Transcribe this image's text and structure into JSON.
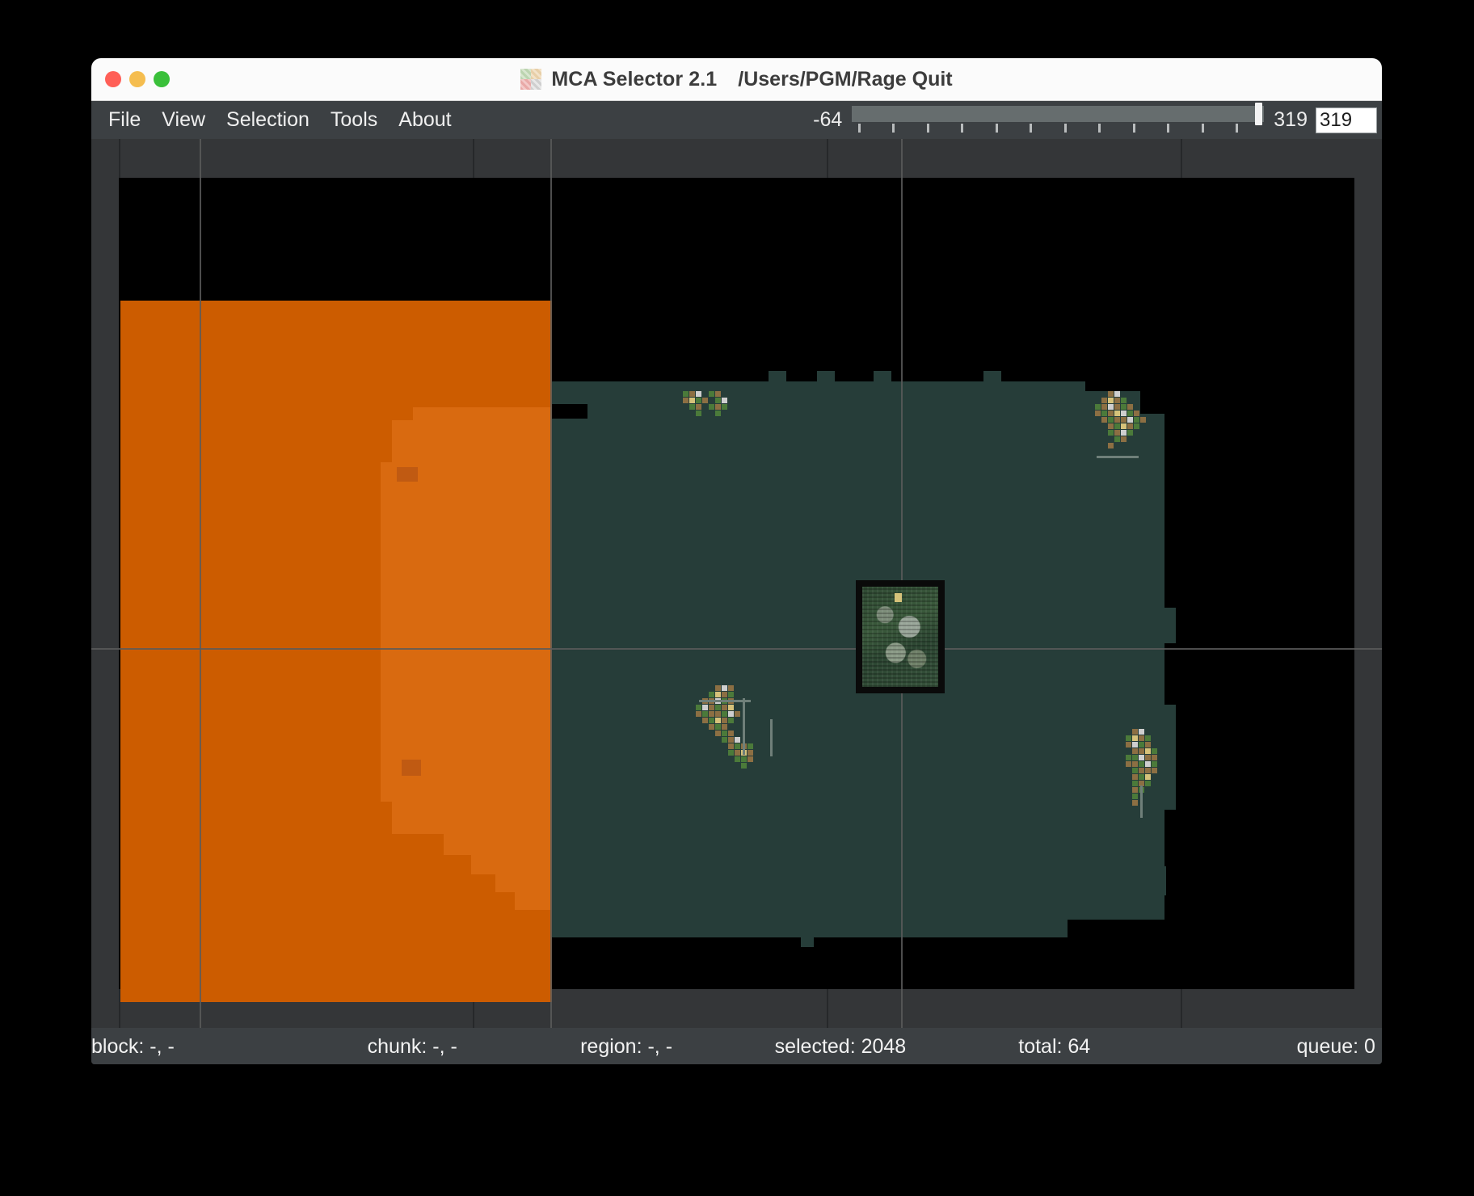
{
  "window": {
    "title": "MCA Selector 2.1",
    "path": "/Users/PGM/Rage Quit",
    "icon": "app-grid-icon",
    "controls": {
      "close": "close-button",
      "minimize": "minimize-button",
      "maximize": "maximize-button"
    }
  },
  "menubar": {
    "items": [
      {
        "label": "File"
      },
      {
        "label": "View"
      },
      {
        "label": "Selection"
      },
      {
        "label": "Tools"
      },
      {
        "label": "About"
      }
    ]
  },
  "height_slider": {
    "min_label": "-64",
    "max_label": "319",
    "value_field": "319",
    "value": 319,
    "min": -64,
    "max": 319,
    "tick_count": 12
  },
  "statusbar": {
    "block": "block: -, -",
    "chunk": "chunk: -, -",
    "region": "region: -, -",
    "selected": "selected: 2048",
    "total": "total: 64",
    "queue": "queue: 0"
  },
  "map": {
    "selection_color": "#cc5c00",
    "selection_soft_color": "#d96a10",
    "terrain_color": "#263d39",
    "background_color": "#000000",
    "chrome_color": "#3c4043",
    "grid_color": "#5a5a5a"
  }
}
